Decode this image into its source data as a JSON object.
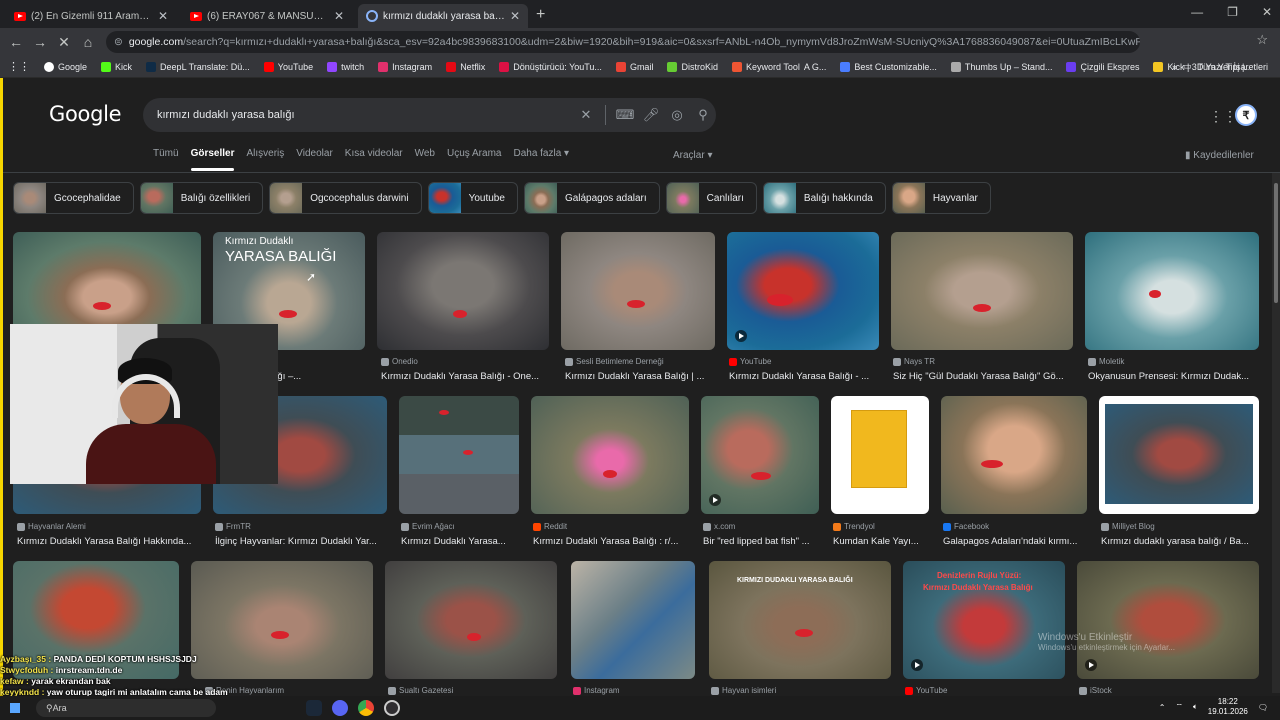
{
  "tabs": [
    {
      "title": "(2) En Gizemli 911 Aramasını Ar",
      "kind": "youtube"
    },
    {
      "title": "(6) ERAY067 & MANSUR - C",
      "kind": "youtube"
    },
    {
      "title": "kırmızı dudaklı yarasa balığı - G",
      "kind": "google"
    }
  ],
  "address": {
    "domain": "google.com",
    "path": "/search?q=kırmızı+dudaklı+yarasa+balığı&sca_esv=92a4bc9839683100&udm=2&biw=1920&bih=919&aic=0&sxsrf=ANbL-n4Ob_nymymVd8JroZmWsM-SUcniyQ%3A1768836049087&ei=0UtuaZmIBcLKwPAPp-GCwAs&oq=k..."
  },
  "bookmarks": [
    "Google",
    "Kick",
    "DeepL Translate: Dü...",
    "YouTube",
    "twitch",
    "Instagram",
    "Netflix",
    "Dönüştürücü: YouTu...",
    "Gmail",
    "DistroKid",
    "Keyword Tool",
    "A G...",
    "Best Customizable...",
    "Thumbs Up – Stand...",
    "Çizgili Ekspres",
    "Kick | 3D Yazı Tipi |..."
  ],
  "bookmarks_all": "Tüm Yer İşaretleri",
  "search": {
    "logo": "Google",
    "query": "kırmızı dudaklı yarasa balığı"
  },
  "filters": [
    "Tümü",
    "Görseller",
    "Alışveriş",
    "Videolar",
    "Kısa videolar",
    "Web",
    "Uçuş Arama",
    "Daha fazla ▾"
  ],
  "filters_active": "Görseller",
  "tools": "Araçlar ▾",
  "saved": "Kaydedilenler",
  "chips": [
    "Gcocephalidae",
    "Balığı özellikleri",
    "Ogcocephalus darwini",
    "Youtube",
    "Galápagos adaları",
    "Canlıları",
    "Balığı hakkında",
    "Hayvanlar"
  ],
  "row1": [
    {
      "source": "",
      "title": ""
    },
    {
      "source": "gisi",
      "title": "Yarasa Balığı –..."
    },
    {
      "source": "Onedio",
      "title": "Kırmızı Dudaklı Yarasa Balığı - One..."
    },
    {
      "source": "Sesli Betimleme Derneği",
      "title": "Kırmızı Dudaklı Yarasa Balığı | ..."
    },
    {
      "source": "YouTube",
      "title": "Kırmızı Dudaklı Yarasa Balığı - ..."
    },
    {
      "source": "Nays TR",
      "title": "Siz Hiç \"Gül Dudaklı Yarasa Balığı\" Gö..."
    },
    {
      "source": "Moletik",
      "title": "Okyanusun Prensesi: Kırmızı Dudak..."
    }
  ],
  "row2": [
    {
      "source": "Hayvanlar Alemi",
      "title": "Kırmızı Dudaklı Yarasa Balığı Hakkında..."
    },
    {
      "source": "FrmTR",
      "title": "İlginç Hayvanlar: Kırmızı Dudaklı Yar..."
    },
    {
      "source": "Evrim Ağacı",
      "title": "Kırmızı Dudaklı Yarasa..."
    },
    {
      "source": "Reddit",
      "title": "Kırmızı Dudaklı Yarasa Balığı : r/..."
    },
    {
      "source": "x.com",
      "title": "Bir \"red lipped bat fish\" ..."
    },
    {
      "source": "Trendyol",
      "title": "Kumdan Kale Yayı..."
    },
    {
      "source": "Facebook",
      "title": "Galapagos Adaları'ndaki kırmı..."
    },
    {
      "source": "Milliyet Blog",
      "title": "Kırmızı dudaklı yarasa balığı / Ba..."
    }
  ],
  "row3_sources": [
    "",
    "Renin Hayvanlarım",
    "Sualtı Gazetesi",
    "Instagram",
    "Hayvan isimleri",
    "YouTube",
    "iStock"
  ],
  "image_text": {
    "tile2_line1": "Kırmızı Dudaklı",
    "tile2_line2": "YARASA BALIĞI",
    "tile_r3_5": "KIRMIZI DUDAKLI YARASA BALIĞI",
    "tile_r3_6a": "Denizlerin Rujlu Yüzü:",
    "tile_r3_6b": "Kırmızı Dudaklı Yarasa Balığı"
  },
  "watermark": "Windows'u Etkinleştir",
  "watermark2": "Windows'u etkinleştirmek için Ayarlar...",
  "chat": [
    {
      "user": "Ayzbaşı_35 :",
      "msg": "PANDA DEDİ KOPTUM HSHSJSJDJ"
    },
    {
      "user": "Stwycfoduh :",
      "msg": "inrstream.tdn.de"
    },
    {
      "user": "kefaw :",
      "msg": "yarak ekrandan bak"
    },
    {
      "user": "keyykndd :",
      "msg": "yaw oturup tagiri mi anlatalım cama be adam"
    }
  ],
  "taskbar": {
    "search": "Ara",
    "time": "18:22",
    "date": "19.01.2026"
  },
  "colors": {
    "chrome_bg": "#202124",
    "page_bg": "#1f1f1f",
    "accent": "#8ab4f8",
    "stream_border": "#f6d600"
  }
}
